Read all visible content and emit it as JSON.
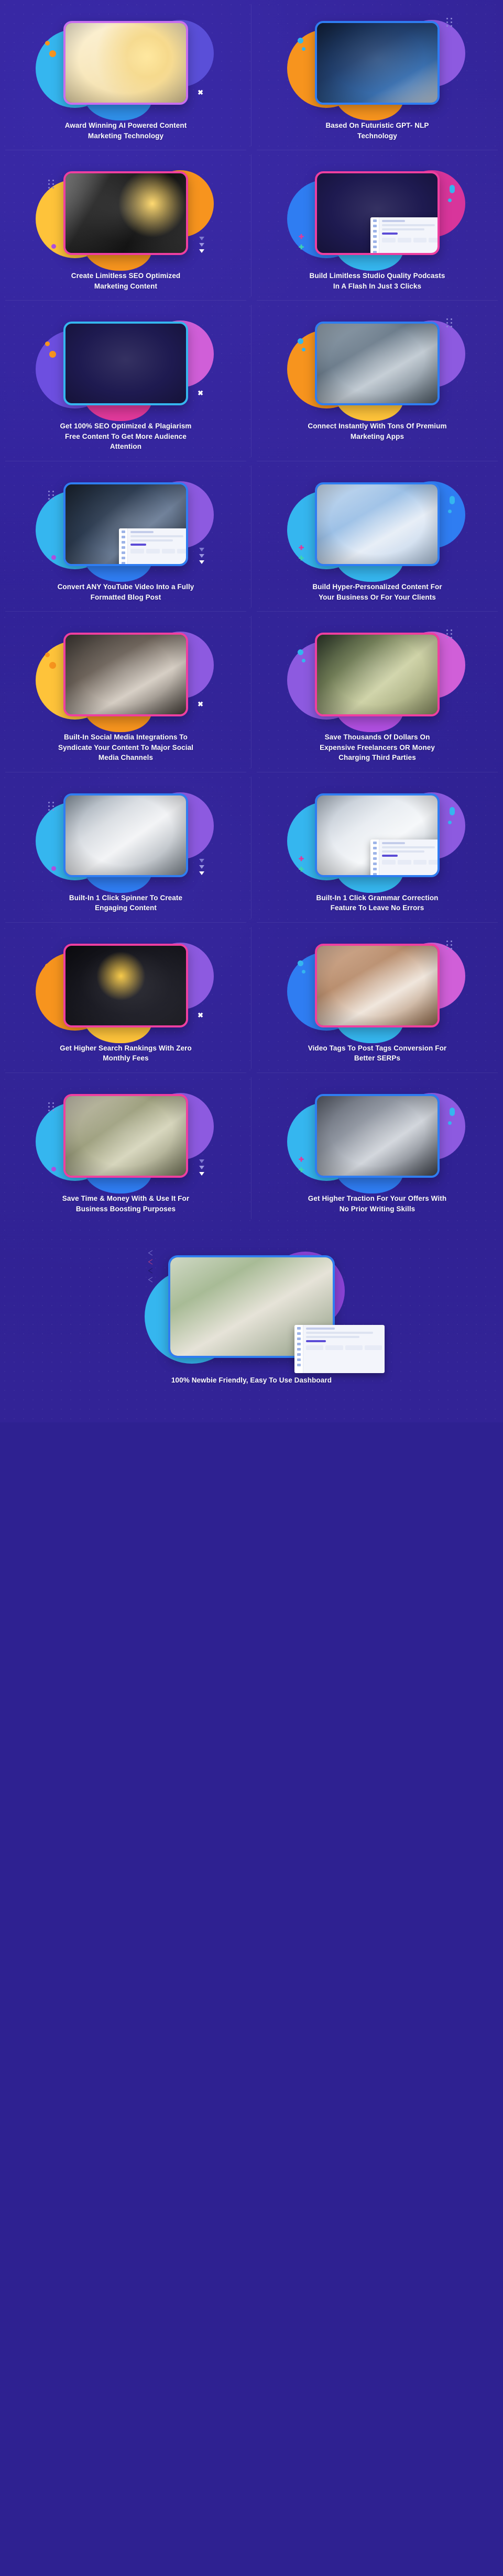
{
  "page": {
    "background_color": "#2e2191",
    "accent_colors": {
      "pink": "#ef3fa0",
      "purple": "#c86ef0",
      "blue": "#2f7df2",
      "cyan": "#35b6ef",
      "orange": "#f7941e",
      "yellow": "#fec33a",
      "magenta": "#e0399b"
    },
    "columns": 2,
    "total_features": 17
  },
  "features": [
    {
      "id": "award-winning-ai",
      "caption": "Award Winning AI Powered Content Marketing Technology",
      "border_color": "#c86ef0",
      "blobs": {
        "left": "#35b6ef",
        "right": "#5a4fd8",
        "bottom": "#2f8fe8"
      },
      "image": "robot-holding-gold-trophy",
      "has_overlay_ui": false
    },
    {
      "id": "futuristic-gpt-nlp",
      "caption": "Based On Futuristic GPT- NLP Technology",
      "border_color": "#2f7df2",
      "blobs": {
        "left": "#f7941e",
        "right": "#8d5ae0",
        "bottom": "#f7941e"
      },
      "image": "hands-typing-on-laptop-with-ai-robot-hand",
      "has_overlay_ui": false
    },
    {
      "id": "limitless-seo-content",
      "caption": "Create Limitless SEO Optimized Marketing Content",
      "border_color": "#ef3fa0",
      "blobs": {
        "left": "#fec33a",
        "right": "#f7941e",
        "bottom": "#f7941e"
      },
      "image": "man-in-seo-shirt-holding-lightbulb",
      "has_overlay_ui": false
    },
    {
      "id": "studio-quality-podcasts",
      "caption": "Build Limitless Studio Quality Podcasts In A Flash In Just 3 Clicks",
      "border_color": "#ef3fa0",
      "blobs": {
        "left": "#2f7df2",
        "right": "#d8359b",
        "bottom": "#35b6ef"
      },
      "image": "two-people-recording-podcast-with-microphones",
      "has_overlay_ui": true
    },
    {
      "id": "plagiarism-free-content",
      "caption": "Get 100% SEO Optimized & Plagiarism Free Content To Get More Audience Attention",
      "border_color": "#35b6ef",
      "blobs": {
        "left": "#6d4fe0",
        "right": "#d05fd8",
        "bottom": "#e0399b"
      },
      "image": "hands-holding-seo-mindmap-paper",
      "has_overlay_ui": false
    },
    {
      "id": "premium-marketing-apps",
      "caption": "Connect Instantly With Tons Of Premium Marketing Apps",
      "border_color": "#2f7df2",
      "blobs": {
        "left": "#f7941e",
        "right": "#8d5ae0",
        "bottom": "#fec33a"
      },
      "image": "hands-holding-phone-with-floating-app-icons",
      "has_overlay_ui": false
    },
    {
      "id": "youtube-to-blog-post",
      "caption": "Convert ANY YouTube Video Into a Fully Formatted Blog Post",
      "border_color": "#2f7df2",
      "blobs": {
        "left": "#35b6ef",
        "right": "#8d5ae0",
        "bottom": "#2f7df2"
      },
      "image": "video-editing-workstation-with-monitors",
      "has_overlay_ui": true
    },
    {
      "id": "hyper-personalized-content",
      "caption": "Build Hyper-Personalized Content For Your Business Or For Your Clients",
      "border_color": "#2f7df2",
      "blobs": {
        "left": "#35b6ef",
        "right": "#2f7df2",
        "bottom": "#35b6ef"
      },
      "image": "hand-touching-floating-interface-screens",
      "has_overlay_ui": false
    },
    {
      "id": "social-media-integrations",
      "caption": "Built-In Social Media Integrations To Syndicate Your Content To Major Social Media Channels",
      "border_color": "#ef3fa0",
      "blobs": {
        "left": "#fec33a",
        "right": "#8d5ae0",
        "bottom": "#f7941e"
      },
      "image": "hand-holding-smartphone-beside-coffee-cup",
      "has_overlay_ui": false
    },
    {
      "id": "save-thousands-of-dollars",
      "caption": "Save Thousands Of Dollars On Expensive Freelancers OR Money Charging Third Parties",
      "border_color": "#ef3fa0",
      "blobs": {
        "left": "#8d5ae0",
        "right": "#d05fd8",
        "bottom": "#b04fe0"
      },
      "image": "hand-holding-fan-of-dollar-bills",
      "has_overlay_ui": false
    },
    {
      "id": "one-click-spinner",
      "caption": "Built-In 1 Click Spinner To Create Engaging Content",
      "border_color": "#2f7df2",
      "blobs": {
        "left": "#35b6ef",
        "right": "#8d5ae0",
        "bottom": "#2f7df2"
      },
      "image": "laptop-with-content-document-on-desk",
      "has_overlay_ui": false
    },
    {
      "id": "grammar-correction",
      "caption": "Built-In 1 Click Grammar Correction Feature To Leave No Errors",
      "border_color": "#2f7df2",
      "blobs": {
        "left": "#35b6ef",
        "right": "#8d5ae0",
        "bottom": "#35b6ef"
      },
      "image": "laptop-showing-dashboard-application",
      "has_overlay_ui": true
    },
    {
      "id": "higher-search-rankings",
      "caption": "Get Higher Search Rankings With Zero Monthly Fees",
      "border_color": "#ef3fa0",
      "blobs": {
        "left": "#f7941e",
        "right": "#8d5ae0",
        "bottom": "#fec33a"
      },
      "image": "hand-pointing-at-five-gold-stars",
      "has_overlay_ui": false
    },
    {
      "id": "video-tags-to-post-tags",
      "caption": "Video Tags To Post Tags Conversion For Better SERPs",
      "border_color": "#ef3fa0",
      "blobs": {
        "left": "#2f7df2",
        "right": "#d05fd8",
        "bottom": "#35b6ef"
      },
      "image": "hand-holding-phone-with-social-reaction-icons",
      "has_overlay_ui": false
    },
    {
      "id": "save-time-and-money",
      "caption": "Save Time & Money With & Use It For Business Boosting Purposes",
      "border_color": "#ef3fa0",
      "blobs": {
        "left": "#35b6ef",
        "right": "#8d5ae0",
        "bottom": "#2f7df2"
      },
      "image": "hourglass-on-stacks-of-money",
      "has_overlay_ui": false
    },
    {
      "id": "higher-traction-for-offers",
      "caption": "Get Higher Traction For Your Offers With No Prior Writing Skills",
      "border_color": "#2f7df2",
      "blobs": {
        "left": "#35b6ef",
        "right": "#8d5ae0",
        "bottom": "#2f7df2"
      },
      "image": "team-meeting-around-table-with-laptops",
      "has_overlay_ui": false
    }
  ],
  "final_feature": {
    "id": "newbie-friendly-dashboard",
    "caption": "100% Newbie Friendly, Easy To Use Dashboard",
    "border_color": "#2f7df2",
    "blobs": {
      "left": "#35b6ef",
      "right": "#8b43d6"
    },
    "image": "two-women-looking-at-laptop-together",
    "has_overlay_ui": true
  }
}
